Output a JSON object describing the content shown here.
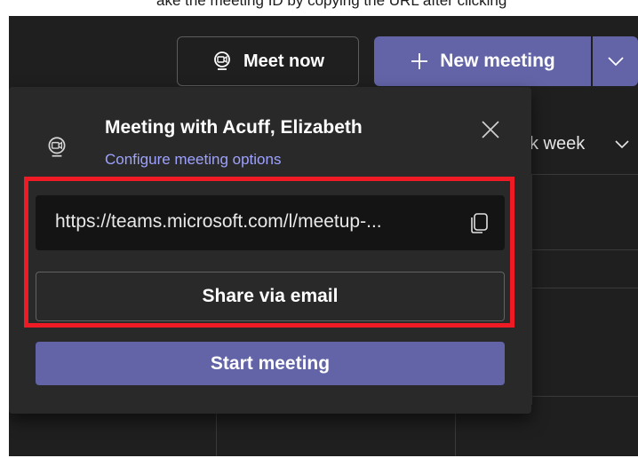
{
  "caption": "ake the meeting ID by copying the URL after clicking",
  "header": {
    "meet_now_label": "Meet now",
    "new_meeting_label": "New meeting"
  },
  "calendar": {
    "view_label": "k week"
  },
  "popup": {
    "title": "Meeting with Acuff, Elizabeth",
    "options_link": "Configure meeting options",
    "meeting_url": "https://teams.microsoft.com/l/meetup-...",
    "share_label": "Share via email",
    "start_label": "Start meeting"
  },
  "colors": {
    "background": "#1f1f1f",
    "popup": "#292929",
    "accent": "#6264a7",
    "link": "#9ea2ff",
    "highlight": "#ee1b24"
  },
  "icons": [
    "video-icon",
    "plus-icon",
    "chevron-down-icon",
    "close-icon",
    "copy-icon"
  ]
}
